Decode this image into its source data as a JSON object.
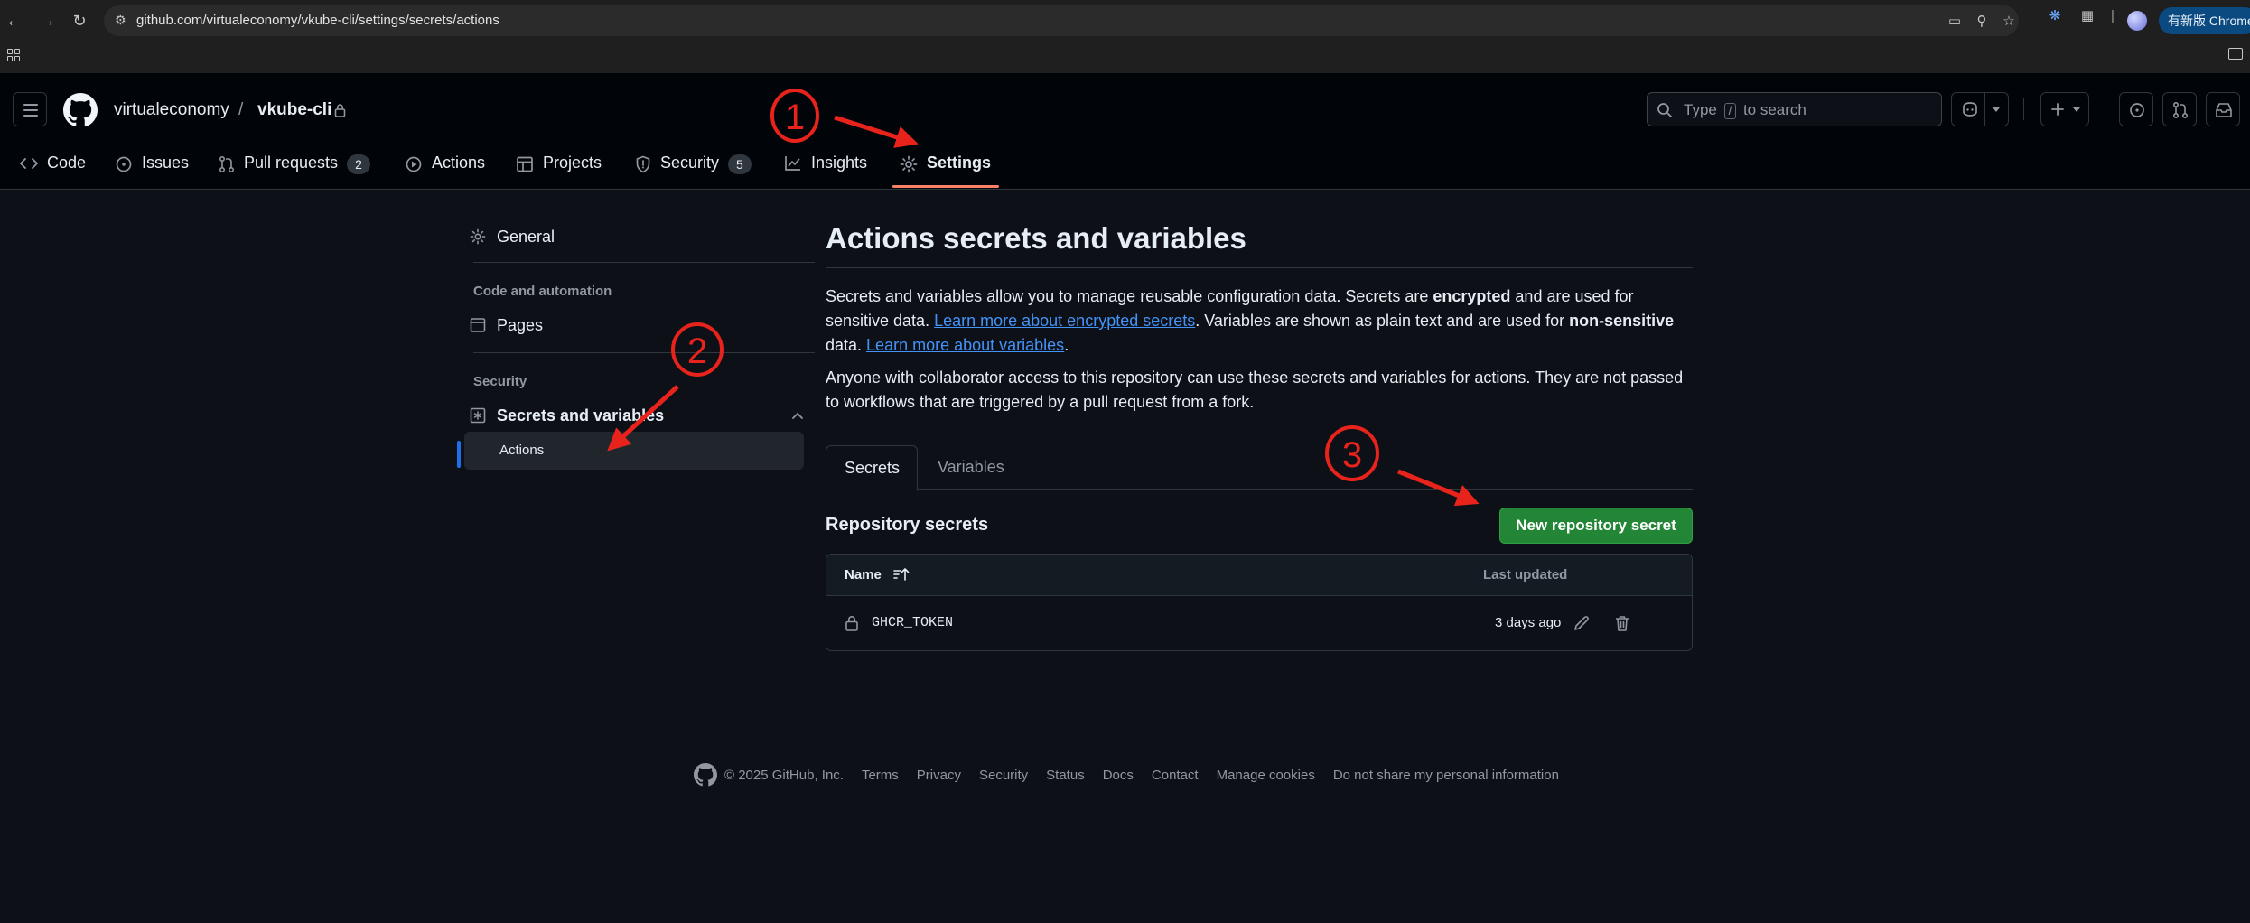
{
  "browser": {
    "url": "github.com/virtualeconomy/vkube-cli/settings/secrets/actions",
    "update_label": "有新版 Chrome"
  },
  "header": {
    "owner": "virtualeconomy",
    "separator": "/",
    "repo": "vkube-cli",
    "search": {
      "prefix": "Type",
      "key": "/",
      "suffix": "to search"
    }
  },
  "repo_nav": [
    {
      "label": "Code",
      "icon": "code-icon"
    },
    {
      "label": "Issues",
      "icon": "issue-icon"
    },
    {
      "label": "Pull requests",
      "icon": "pull-request-icon",
      "count": "2"
    },
    {
      "label": "Actions",
      "icon": "play-icon"
    },
    {
      "label": "Projects",
      "icon": "table-icon"
    },
    {
      "label": "Security",
      "icon": "shield-icon",
      "count": "5"
    },
    {
      "label": "Insights",
      "icon": "graph-icon"
    },
    {
      "label": "Settings",
      "icon": "gear-icon",
      "selected": true
    }
  ],
  "sidebar": {
    "general": "General",
    "code_automation_heading": "Code and automation",
    "pages": "Pages",
    "security_heading": "Security",
    "secrets_vars": "Secrets and variables",
    "actions": "Actions"
  },
  "main": {
    "title": "Actions secrets and variables",
    "p1_a": "Secrets and variables allow you to manage reusable configuration data. Secrets are ",
    "p1_b": "encrypted",
    "p1_c": " and are used for sensitive data. ",
    "p1_link1": "Learn more about encrypted secrets",
    "p1_d": ". Variables are shown as plain text and are used for ",
    "p1_e": "non-sensitive",
    "p1_f": " data. ",
    "p1_link2": "Learn more about variables",
    "p1_g": ".",
    "p2": "Anyone with collaborator access to this repository can use these secrets and variables for actions. They are not passed to workflows that are triggered by a pull request from a fork.",
    "tabs": [
      "Secrets",
      "Variables"
    ],
    "section_title": "Repository secrets",
    "new_button": "New repository secret",
    "table": {
      "col_name": "Name",
      "col_updated": "Last updated",
      "rows": [
        {
          "name": "GHCR_TOKEN",
          "updated": "3 days ago"
        }
      ]
    }
  },
  "footer": {
    "copyright": "© 2025 GitHub, Inc.",
    "links": [
      "Terms",
      "Privacy",
      "Security",
      "Status",
      "Docs",
      "Contact",
      "Manage cookies",
      "Do not share my personal information"
    ]
  },
  "annotations": [
    "1",
    "2",
    "3"
  ],
  "colors": {
    "accent_underline": "#f78166",
    "link": "#4493f8",
    "primary_button": "#238636",
    "annotation": "#e8231b"
  }
}
